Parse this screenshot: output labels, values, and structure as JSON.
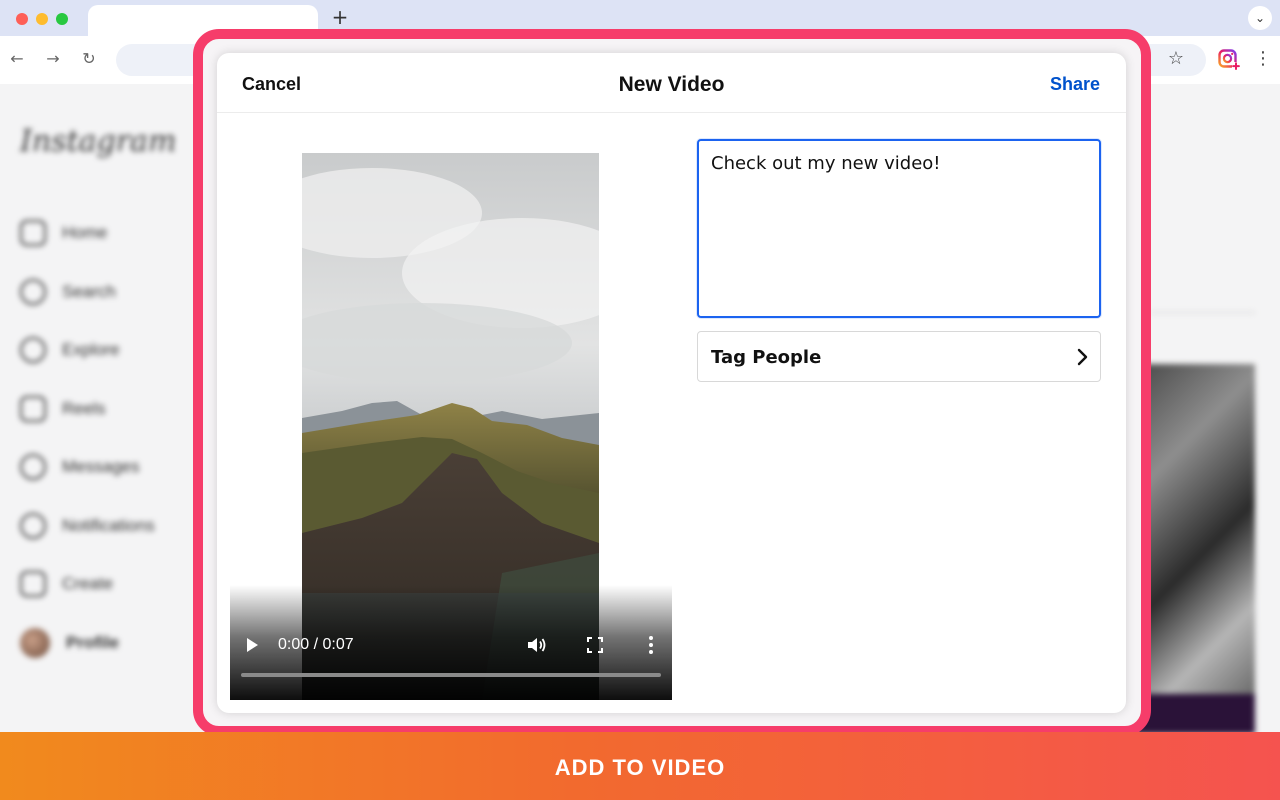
{
  "browser": {
    "new_tab_glyph": "+",
    "tab_menu_glyph": "⌄",
    "back_glyph": "←",
    "forward_glyph": "→",
    "reload_glyph": "↻",
    "bookmark_glyph": "☆",
    "menu_glyph": "⋮",
    "extension_icon": "instagram-upload-extension-icon"
  },
  "background_page": {
    "logo": "Instagram",
    "nav": [
      {
        "label": "Home",
        "icon": "home-icon"
      },
      {
        "label": "Search",
        "icon": "search-icon"
      },
      {
        "label": "Explore",
        "icon": "compass-icon"
      },
      {
        "label": "Reels",
        "icon": "reels-icon"
      },
      {
        "label": "Messages",
        "icon": "messenger-icon"
      },
      {
        "label": "Notifications",
        "icon": "heart-icon"
      },
      {
        "label": "Create",
        "icon": "plus-square-icon"
      },
      {
        "label": "Profile",
        "icon": "avatar"
      }
    ]
  },
  "dialog": {
    "cancel_label": "Cancel",
    "title": "New Video",
    "share_label": "Share",
    "caption_value": "Check out my new video!",
    "tag_people_label": "Tag People"
  },
  "video": {
    "time_display": "0:00 / 0:07",
    "progress": 0
  },
  "banner": {
    "label": "ADD TO VIDEO"
  },
  "colors": {
    "highlight": "#f63d6a",
    "share_blue": "#0052cc",
    "banner_start": "#f18a1d",
    "banner_end": "#f5534f",
    "caption_border": "#1b63f0"
  }
}
